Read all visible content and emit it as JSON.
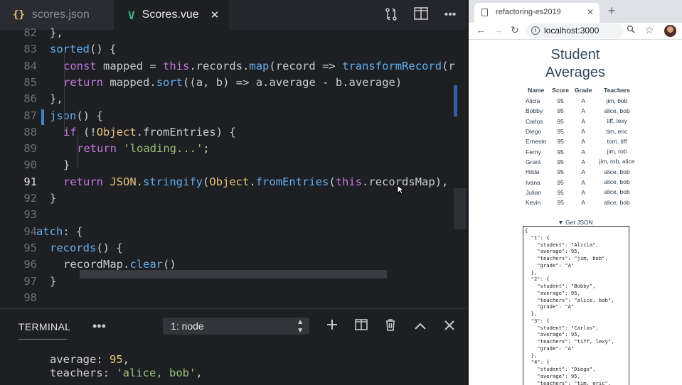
{
  "editor": {
    "tabs": [
      {
        "label": "scores.json",
        "icon": "{}"
      },
      {
        "label": "Scores.vue",
        "icon": "V"
      }
    ],
    "lines": [
      {
        "n": "82",
        "text": "},"
      },
      {
        "n": "83",
        "text": "sorted() {"
      },
      {
        "n": "84",
        "text": "const mapped = this.records.map(record => transformRecord(r"
      },
      {
        "n": "85",
        "text": "return mapped.sort((a, b) => a.average - b.average)"
      },
      {
        "n": "86",
        "text": "},"
      },
      {
        "n": "87",
        "text": "json() {"
      },
      {
        "n": "88",
        "text": "if (!Object.fromEntries) {"
      },
      {
        "n": "89",
        "text": "return 'loading...';"
      },
      {
        "n": "90",
        "text": "}"
      },
      {
        "n": "91",
        "text": "return JSON.stringify(Object.fromEntries(this.recordsMap),"
      },
      {
        "n": "92",
        "text": "}"
      },
      {
        "n": "93",
        "text": ""
      },
      {
        "n": "94",
        "text": "atch: {"
      },
      {
        "n": "95",
        "text": "records() {"
      },
      {
        "n": "96",
        "text": "recordMap.clear()"
      },
      {
        "n": "97",
        "text": "}"
      },
      {
        "n": "98",
        "text": ""
      }
    ],
    "current_line": "91"
  },
  "terminal": {
    "tab_label": "TERMINAL",
    "selected_shell": "1: node",
    "output": {
      "line1_key": "average: ",
      "line1_val": "95",
      "line1_end": ",",
      "line2_key": "teachers: ",
      "line2_val": "'alice, bob'",
      "line2_end": ","
    }
  },
  "browser": {
    "tab_title": "refactoring-es2019",
    "url": "localhost:3000",
    "page_title_line1": "Student",
    "page_title_line2": "Averages",
    "table": {
      "headers": [
        "Name",
        "Score",
        "Grade",
        "Teachers"
      ],
      "rows": [
        [
          "Alicia",
          "95",
          "A",
          "jim, bob"
        ],
        [
          "Bobby",
          "95",
          "A",
          "alice, bob"
        ],
        [
          "Carlos",
          "95",
          "A",
          "tiff, lexy"
        ],
        [
          "Diego",
          "95",
          "A",
          "tim, eric"
        ],
        [
          "Ernesto",
          "95",
          "A",
          "tom, tiff"
        ],
        [
          "Ferny",
          "95",
          "A",
          "jim, rob"
        ],
        [
          "Grant",
          "95",
          "A",
          "jim, rob, alice"
        ],
        [
          "Hilda",
          "95",
          "A",
          "alice, bob"
        ],
        [
          "Ivana",
          "95",
          "A",
          "alice, bob"
        ],
        [
          "Julian",
          "95",
          "A",
          "alice, bob"
        ],
        [
          "Kevin",
          "95",
          "A",
          "alice, bob"
        ]
      ]
    },
    "json_toggle": "▼ Get JSON",
    "json_text": "{\n  \"1\": {\n    \"student\": \"Alicia\",\n    \"average\": 95,\n    \"teachers\": \"jim, bob\",\n    \"grade\": \"A\"\n  },\n  \"2\": {\n    \"student\": \"Bobby\",\n    \"average\": 95,\n    \"teachers\": \"alice, bob\",\n    \"grade\": \"A\"\n  },\n  \"3\": {\n    \"student\": \"Carlos\",\n    \"average\": 95,\n    \"teachers\": \"tiff, lexy\",\n    \"grade\": \"A\"\n  },\n  \"4\": {\n    \"student\": \"Diego\",\n    \"average\": 95,\n    \"teachers\": \"tim, eric\","
  }
}
